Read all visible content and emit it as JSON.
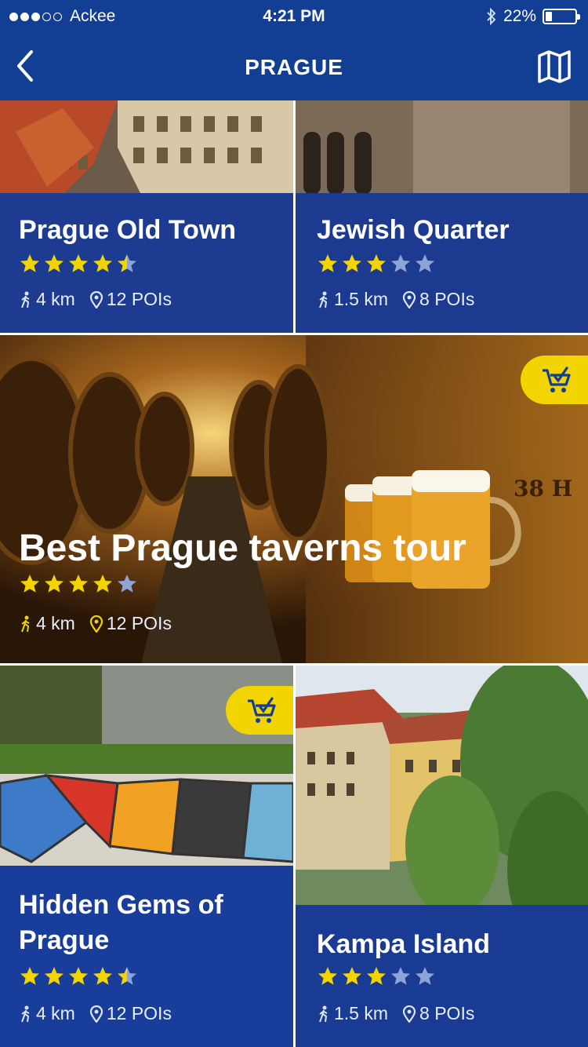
{
  "status": {
    "carrier": "Ackee",
    "time": "4:21 PM",
    "battery": "22%",
    "battery_level": 0.22,
    "signal_bars": 3,
    "signal_total": 5
  },
  "nav": {
    "title": "PRAGUE"
  },
  "colors": {
    "primary": "#123e94",
    "band": "#1437a0",
    "accent": "#f2d400",
    "star": "#f2d400",
    "star_empty": "#8ea3d6"
  },
  "tours": [
    {
      "name": "Prague Old Town",
      "rating": 4.5,
      "distance": "4 km",
      "pois": "12 POIs",
      "in_cart": false
    },
    {
      "name": "Jewish Quarter",
      "rating": 3,
      "distance": "1.5 km",
      "pois": "8 POIs",
      "in_cart": false
    },
    {
      "name": "Best Prague taverns tour",
      "rating": 4,
      "distance": "4 km",
      "pois": "12 POIs",
      "in_cart": true
    },
    {
      "name_line1": "Hidden Gems of",
      "name_line2": "Prague",
      "rating": 4.5,
      "distance": "4 km",
      "pois": "12 POIs",
      "in_cart": true
    },
    {
      "name": "Kampa Island",
      "rating": 3,
      "distance": "1.5 km",
      "pois": "8 POIs",
      "in_cart": false
    }
  ]
}
